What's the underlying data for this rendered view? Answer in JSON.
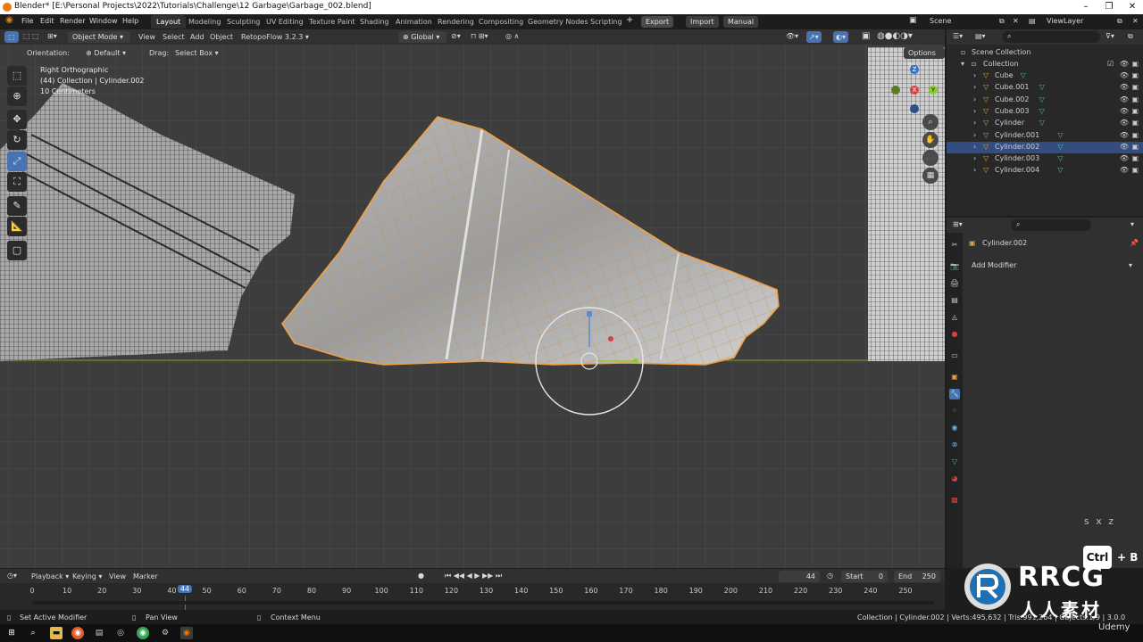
{
  "window": {
    "title": "Blender* [E:\\Personal Projects\\2022\\Tutorials\\Challenge\\12 Garbage\\Garbage_002.blend]"
  },
  "menu": [
    "File",
    "Edit",
    "Render",
    "Window",
    "Help"
  ],
  "workspaces": [
    "Layout",
    "Modeling",
    "Sculpting",
    "UV Editing",
    "Texture Paint",
    "Shading",
    "Animation",
    "Rendering",
    "Compositing",
    "Geometry Nodes",
    "Scripting"
  ],
  "addons": {
    "export": "Export",
    "import": "Import",
    "manual": "Manual"
  },
  "scene": {
    "name": "Scene",
    "view_layer": "ViewLayer"
  },
  "viewport_header": {
    "mode": "Object Mode",
    "menus": [
      "View",
      "Select",
      "Add",
      "Object"
    ],
    "addon": "RetopoFlow 3.2.3",
    "transform": "Global",
    "orientation_label": "Orientation:",
    "orientation_value": "Default",
    "drag_label": "Drag:",
    "drag_value": "Select Box",
    "options": "Options"
  },
  "viewport_overlay": {
    "view": "Right Orthographic",
    "collection": "(44) Collection | Cylinder.002",
    "scale": "10 Centimeters"
  },
  "gizmo": {
    "z": "Z",
    "x": "X",
    "y": "Y"
  },
  "outliner": {
    "root": "Scene Collection",
    "collection": "Collection",
    "items": [
      {
        "name": "Cube",
        "selected": false
      },
      {
        "name": "Cube.001",
        "selected": false
      },
      {
        "name": "Cube.002",
        "selected": false
      },
      {
        "name": "Cube.003",
        "selected": false
      },
      {
        "name": "Cylinder",
        "selected": false
      },
      {
        "name": "Cylinder.001",
        "selected": false
      },
      {
        "name": "Cylinder.002",
        "selected": true
      },
      {
        "name": "Cylinder.003",
        "selected": false
      },
      {
        "name": "Cylinder.004",
        "selected": false
      }
    ]
  },
  "properties": {
    "object": "Cylinder.002",
    "add_modifier": "Add Modifier"
  },
  "timeline": {
    "menus": [
      "Playback",
      "Keying",
      "View",
      "Marker"
    ],
    "current_frame": "44",
    "start_label": "Start",
    "start": "0",
    "end_label": "End",
    "end": "250",
    "ticks": [
      "0",
      "10",
      "20",
      "30",
      "40",
      "50",
      "60",
      "70",
      "80",
      "90",
      "100",
      "110",
      "120",
      "130",
      "140",
      "150",
      "160",
      "170",
      "180",
      "190",
      "200",
      "210",
      "220",
      "230",
      "240",
      "250"
    ]
  },
  "status": {
    "left": "Set Active Modifier",
    "middle": "Pan View",
    "context": "Context Menu",
    "right": "Collection | Cylinder.002 | Verts:495,632 | Tris:991,264 | Objects:1/9 | 3.0.0"
  },
  "keys": {
    "ctrl": "Ctrl",
    "plus_b": "+ B",
    "sxz": "s x z"
  },
  "watermark": {
    "brand": "RRCG",
    "cn": "人人素材",
    "udemy": "Udemy"
  },
  "colors": {
    "accent": "#4772b3",
    "selection": "#e8a23a",
    "bg": "#3d3d3d"
  }
}
